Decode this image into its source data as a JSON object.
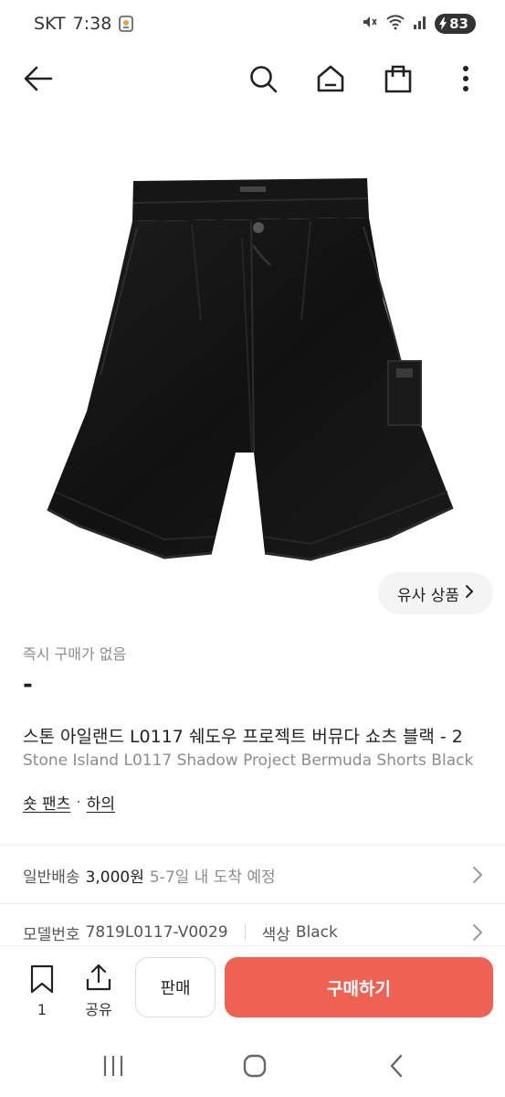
{
  "status_bar": {
    "carrier": "SKT",
    "time": "7:38",
    "battery": "83",
    "icons": [
      "notification-icon",
      "mute-icon",
      "wifi-icon",
      "signal-icon",
      "battery-charging-icon"
    ]
  },
  "nav": {
    "icons": [
      "back-arrow-icon",
      "search-icon",
      "home-icon",
      "shopping-bag-icon",
      "more-vertical-icon"
    ]
  },
  "similar": {
    "label": "유사 상품"
  },
  "product": {
    "instant_purchase": "즉시 구매가 없음",
    "price": "-",
    "title_ko": "스톤 아일랜드 L0117 쉐도우 프로젝트 버뮤다 쇼츠 블랙 - 2",
    "title_en": "Stone Island L0117 Shadow Project Bermuda Shorts Black",
    "breadcrumb": [
      "숏 팬츠",
      "하의"
    ],
    "breadcrumb_sep": "·"
  },
  "shipping": {
    "label": "일반배송",
    "price": "3,000원",
    "eta": "5-7일 내 도착 예정"
  },
  "model": {
    "label": "모델번호",
    "value": "7819L0117-V0029",
    "color_label": "색상",
    "color_value": "Black"
  },
  "actions": {
    "wish_count": "1",
    "share_label": "공유",
    "sell_label": "판매",
    "buy_label": "구매하기"
  },
  "colors": {
    "accent": "#ef6253",
    "text_primary": "#222222",
    "text_secondary": "#8c8c8c"
  }
}
